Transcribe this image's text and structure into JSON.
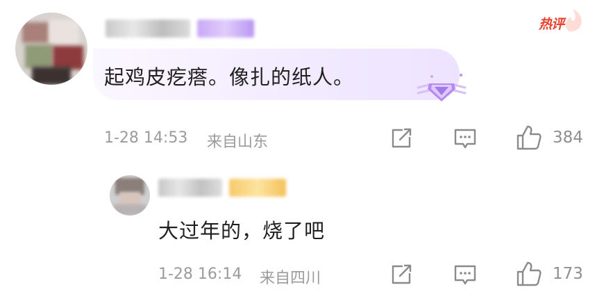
{
  "badge": {
    "hot_label": "热评"
  },
  "comments": [
    {
      "text": "起鸡皮疙瘩。像扎的纸人。",
      "time": "1-28 14:53",
      "location": "来自山东",
      "likes": "384"
    },
    {
      "text": "大过年的，烧了吧",
      "time": "1-28 16:14",
      "location": "来自四川",
      "likes": "173"
    }
  ],
  "colors": {
    "hot": "#e8412e",
    "bubble": "#f2eaff",
    "meta": "#9b9b9b",
    "icon": "#8a8a8a"
  },
  "icons": [
    "share-icon",
    "comment-icon",
    "thumbs-up-icon",
    "purple-diamond-badge-icon",
    "flame-icon"
  ]
}
